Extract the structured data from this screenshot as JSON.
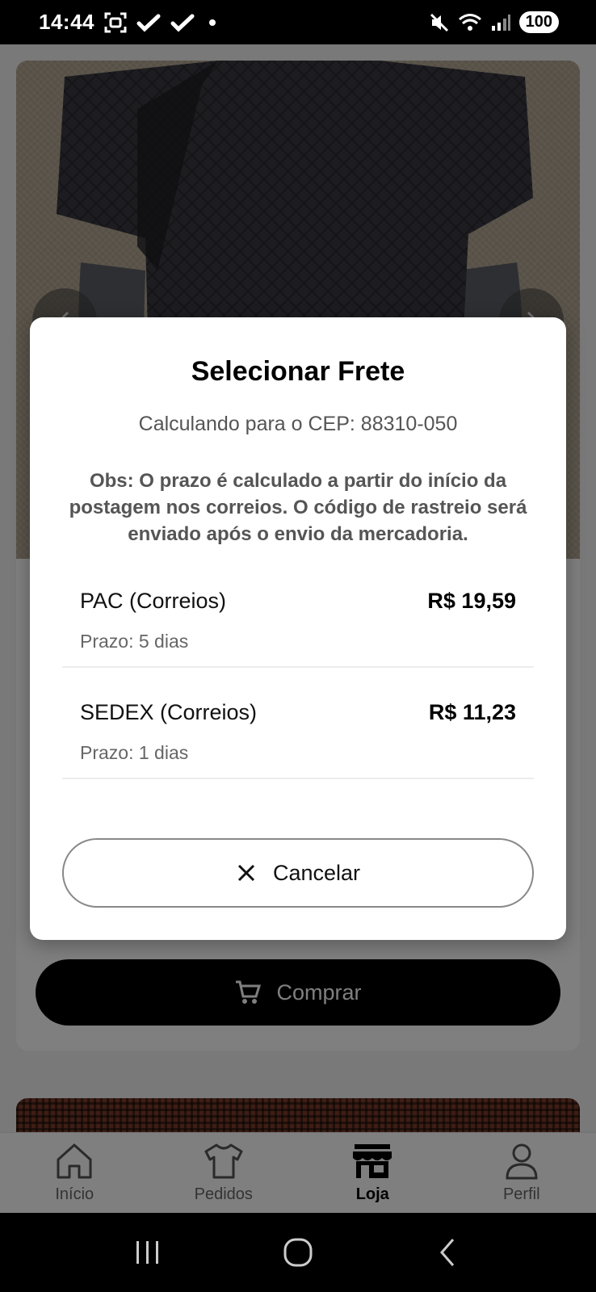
{
  "status_bar": {
    "time": "14:44",
    "battery": "100"
  },
  "product": {
    "buy_label": "Comprar"
  },
  "bottom_nav": {
    "items": [
      {
        "label": "Início",
        "icon": "home-icon"
      },
      {
        "label": "Pedidos",
        "icon": "shirt-icon"
      },
      {
        "label": "Loja",
        "icon": "store-icon",
        "active": true
      },
      {
        "label": "Perfil",
        "icon": "user-icon"
      }
    ]
  },
  "dialog": {
    "title": "Selecionar Frete",
    "subtitle": "Calculando para o CEP: 88310-050",
    "note": "Obs: O prazo é calculado a partir do início da postagem nos correios. O código de rastreio será enviado após o envio da mercadoria.",
    "options": [
      {
        "name": "PAC (Correios)",
        "price": "R$ 19,59",
        "eta": "Prazo: 5 dias"
      },
      {
        "name": "SEDEX (Correios)",
        "price": "R$ 11,23",
        "eta": "Prazo: 1 dias"
      }
    ],
    "cancel_label": "Cancelar"
  }
}
